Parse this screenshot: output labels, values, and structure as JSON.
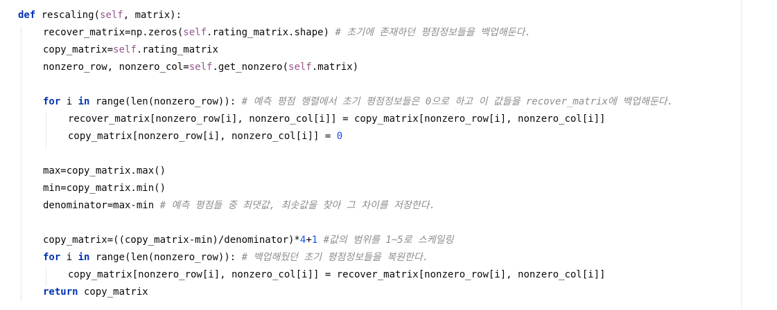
{
  "lines": [
    {
      "indent": 0,
      "tokens": [
        {
          "t": "def",
          "c": "kw"
        },
        {
          "t": " rescaling(",
          "c": "plain"
        },
        {
          "t": "self",
          "c": "self"
        },
        {
          "t": ", matrix):",
          "c": "plain"
        }
      ]
    },
    {
      "indent": 1,
      "tokens": [
        {
          "t": "recover_matrix=np.zeros(",
          "c": "plain"
        },
        {
          "t": "self",
          "c": "self"
        },
        {
          "t": ".rating_matrix.shape) ",
          "c": "plain"
        },
        {
          "t": "# 초기에 존재하던 평점정보들을 백업해둔다.",
          "c": "cm"
        }
      ]
    },
    {
      "indent": 1,
      "tokens": [
        {
          "t": "copy_matrix=",
          "c": "plain"
        },
        {
          "t": "self",
          "c": "self"
        },
        {
          "t": ".rating_matrix",
          "c": "plain"
        }
      ]
    },
    {
      "indent": 1,
      "tokens": [
        {
          "t": "nonzero_row, nonzero_col=",
          "c": "plain"
        },
        {
          "t": "self",
          "c": "self"
        },
        {
          "t": ".get_nonzero(",
          "c": "plain"
        },
        {
          "t": "self",
          "c": "self"
        },
        {
          "t": ".matrix)",
          "c": "plain"
        }
      ]
    },
    {
      "indent": 0,
      "tokens": []
    },
    {
      "indent": 1,
      "tokens": [
        {
          "t": "for",
          "c": "kw"
        },
        {
          "t": " i ",
          "c": "plain"
        },
        {
          "t": "in",
          "c": "kw"
        },
        {
          "t": " range(len(nonzero_row)): ",
          "c": "plain"
        },
        {
          "t": "# 예측 평점 행렬에서 초기 평점정보들은 0으로 하고 이 값들을 recover_matrix에 백업해둔다.",
          "c": "cm"
        }
      ]
    },
    {
      "indent": 2,
      "tokens": [
        {
          "t": "recover_matrix[nonzero_row[i], nonzero_col[i]] = copy_matrix[nonzero_row[i], nonzero_col[i]]",
          "c": "plain"
        }
      ]
    },
    {
      "indent": 2,
      "tokens": [
        {
          "t": "copy_matrix[nonzero_row[i], nonzero_col[i]] = ",
          "c": "plain"
        },
        {
          "t": "0",
          "c": "num"
        }
      ]
    },
    {
      "indent": 0,
      "tokens": []
    },
    {
      "indent": 1,
      "tokens": [
        {
          "t": "max=copy_matrix.max()",
          "c": "plain"
        }
      ]
    },
    {
      "indent": 1,
      "tokens": [
        {
          "t": "min=copy_matrix.min()",
          "c": "plain"
        }
      ]
    },
    {
      "indent": 1,
      "tokens": [
        {
          "t": "denominator=max-min ",
          "c": "plain"
        },
        {
          "t": "# 예측 평점들 중 최댓값, 최솟값을 찾아 그 차이를 저장한다.",
          "c": "cm"
        }
      ]
    },
    {
      "indent": 0,
      "tokens": []
    },
    {
      "indent": 1,
      "tokens": [
        {
          "t": "copy_matrix=((copy_matrix-min)/denominator)*",
          "c": "plain"
        },
        {
          "t": "4",
          "c": "num"
        },
        {
          "t": "+",
          "c": "plain"
        },
        {
          "t": "1",
          "c": "num"
        },
        {
          "t": " ",
          "c": "plain"
        },
        {
          "t": "#값의 범위를 1~5로 스케일링",
          "c": "cm"
        }
      ]
    },
    {
      "indent": 1,
      "tokens": [
        {
          "t": "for",
          "c": "kw"
        },
        {
          "t": " i ",
          "c": "plain"
        },
        {
          "t": "in",
          "c": "kw"
        },
        {
          "t": " range(len(nonzero_row)): ",
          "c": "plain"
        },
        {
          "t": "# 백업해뒀던 초기 평점정보들을 복원한다.",
          "c": "cm"
        }
      ]
    },
    {
      "indent": 2,
      "tokens": [
        {
          "t": "copy_matrix[nonzero_row[i], nonzero_col[i]] = recover_matrix[nonzero_row[i], nonzero_col[i]]",
          "c": "plain"
        }
      ]
    },
    {
      "indent": 1,
      "tokens": [
        {
          "t": "return",
          "c": "kw"
        },
        {
          "t": " copy_matrix",
          "c": "plain"
        }
      ]
    }
  ],
  "colors": {
    "keyword": "#0033b3",
    "self": "#94558d",
    "number": "#1750eb",
    "comment": "#8c8c8c",
    "text": "#080808",
    "background": "#ffffff"
  }
}
